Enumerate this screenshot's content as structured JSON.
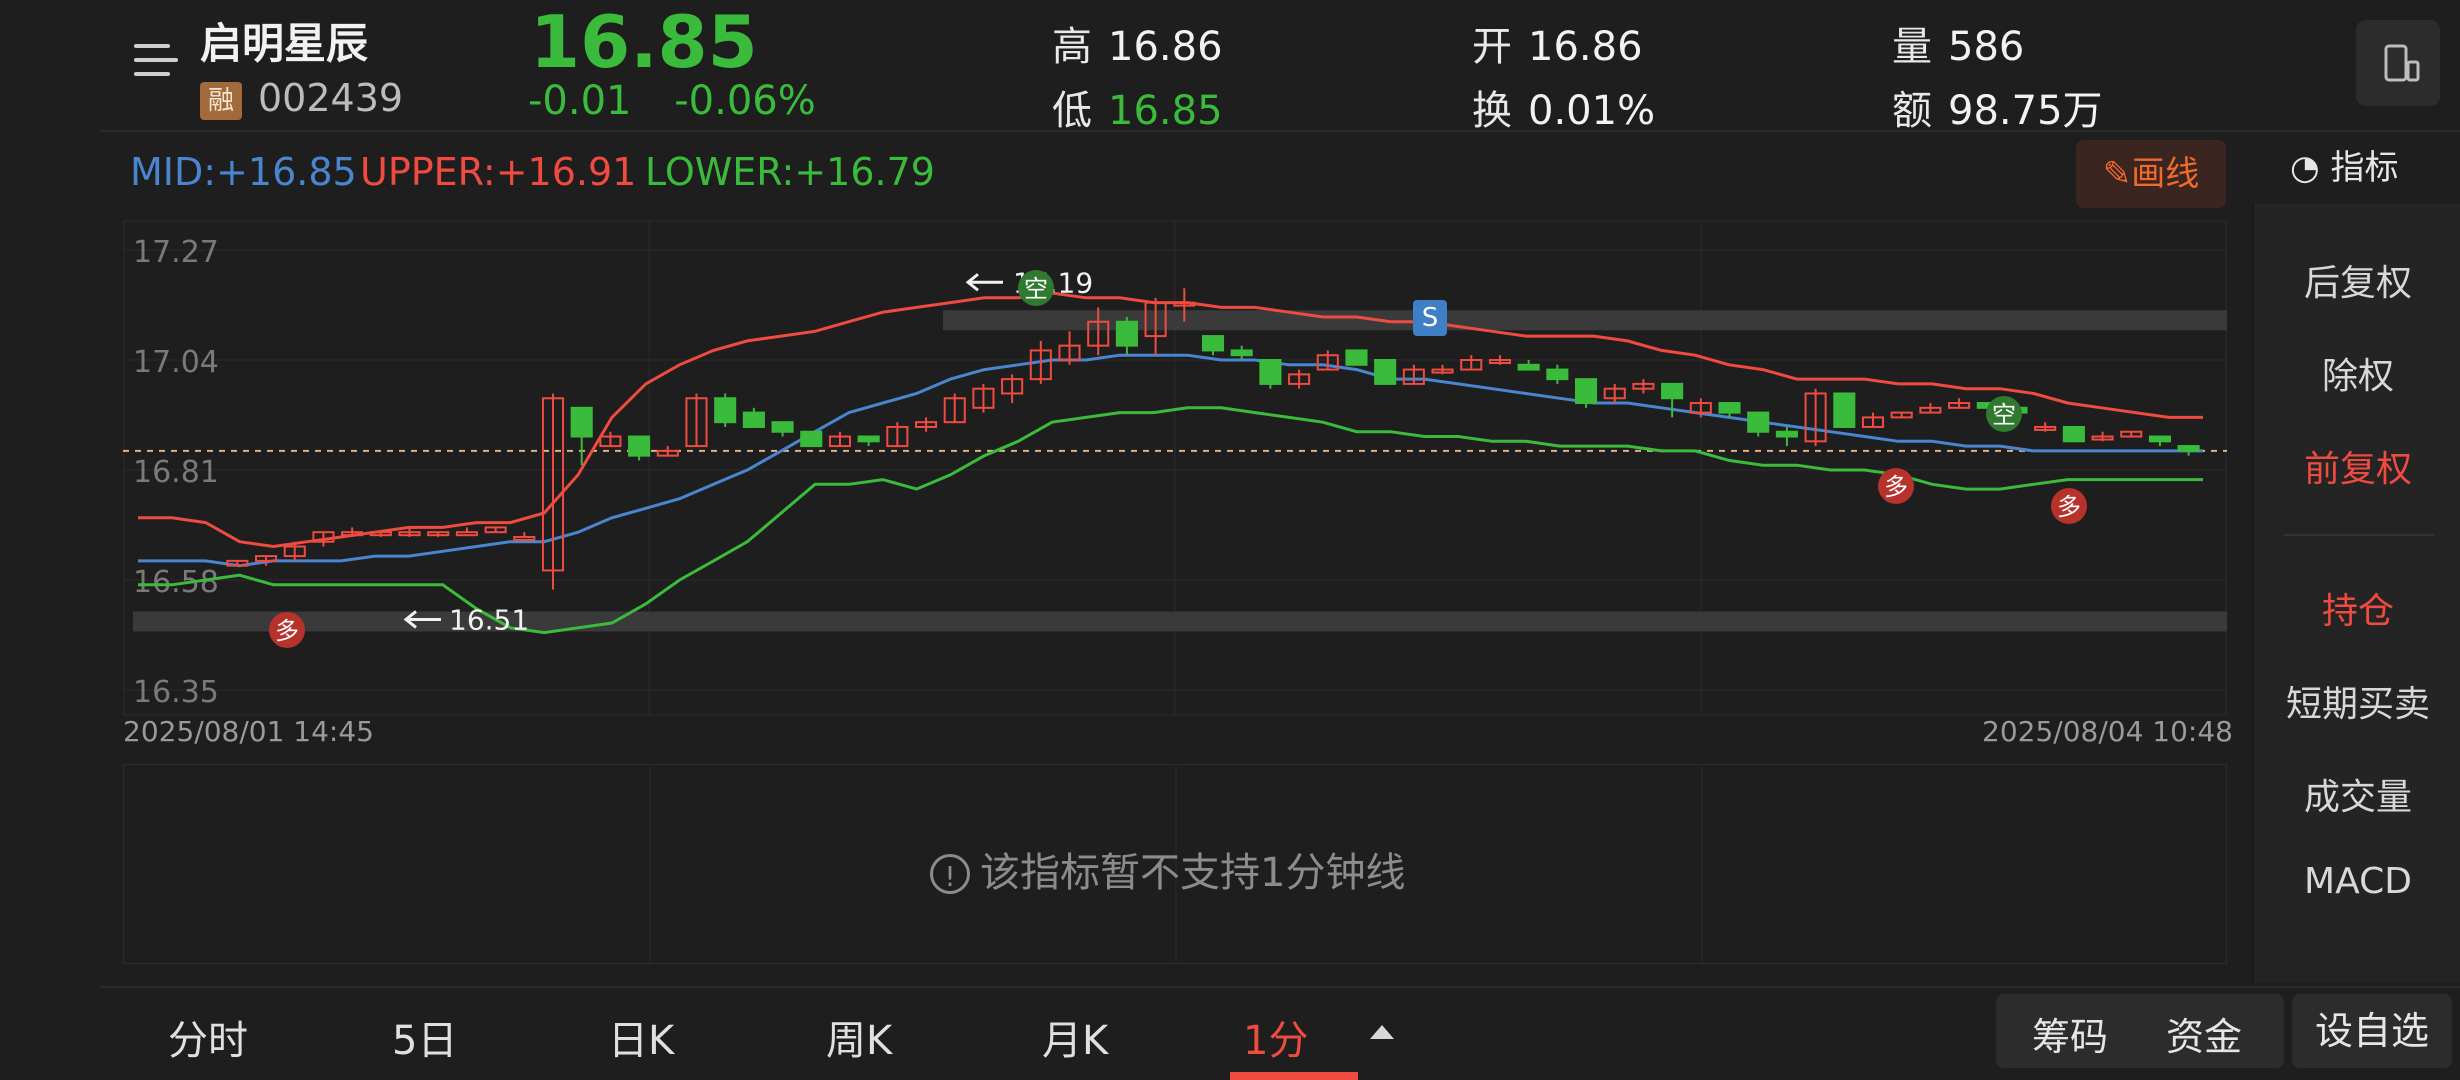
{
  "header": {
    "stock_name": "启明星辰",
    "margin_badge": "融",
    "stock_code": "002439",
    "price": "16.85",
    "change": "-0.01",
    "change_pct": "-0.06%",
    "high_label": "高",
    "high_value": "16.86",
    "low_label": "低",
    "low_value": "16.85",
    "open_label": "开",
    "open_value": "16.86",
    "turnover_label": "换",
    "turnover_value": "0.01%",
    "volume_label": "量",
    "volume_value": "586",
    "amount_label": "额",
    "amount_value": "98.75万",
    "price_color": "#3bbb3b"
  },
  "indicators": {
    "mid": "MID:+16.85",
    "upper": "UPPER:+16.91",
    "lower": "LOWER:+16.79",
    "mid_color": "#4a86d0",
    "upper_color": "#ef4b40",
    "lower_color": "#3bbb3b"
  },
  "toolbar": {
    "draw_label": "画线",
    "indicator_label": "指标"
  },
  "chart_data": {
    "type": "candlestick",
    "ylim": [
      16.35,
      17.27
    ],
    "y_ticks": [
      "17.27",
      "17.04",
      "16.81",
      "16.58",
      "16.35"
    ],
    "reference_price": 16.85,
    "start_label": "2025/08/01 14:45",
    "end_label": "2025/08/04 10:48",
    "annotations": {
      "max_label": "17.19",
      "min_label": "16.51",
      "sell_marker": "S",
      "long_marker": "多",
      "short_marker": "空"
    },
    "bands": {
      "upper": [
        16.71,
        16.71,
        16.7,
        16.66,
        16.65,
        16.66,
        16.67,
        16.68,
        16.69,
        16.69,
        16.7,
        16.7,
        16.72,
        16.8,
        16.92,
        16.99,
        17.03,
        17.06,
        17.08,
        17.09,
        17.1,
        17.12,
        17.14,
        17.15,
        17.16,
        17.17,
        17.17,
        17.18,
        17.17,
        17.17,
        17.16,
        17.16,
        17.15,
        17.15,
        17.14,
        17.13,
        17.13,
        17.12,
        17.12,
        17.11,
        17.1,
        17.09,
        17.09,
        17.09,
        17.08,
        17.06,
        17.05,
        17.03,
        17.02,
        17.0,
        17.0,
        17.0,
        16.99,
        16.99,
        16.98,
        16.98,
        16.97,
        16.95,
        16.94,
        16.93,
        16.92,
        16.92
      ],
      "mid": [
        16.62,
        16.62,
        16.62,
        16.61,
        16.62,
        16.62,
        16.62,
        16.63,
        16.63,
        16.64,
        16.65,
        16.66,
        16.66,
        16.68,
        16.71,
        16.73,
        16.75,
        16.78,
        16.81,
        16.85,
        16.89,
        16.93,
        16.95,
        16.97,
        17.0,
        17.02,
        17.03,
        17.04,
        17.04,
        17.05,
        17.05,
        17.05,
        17.04,
        17.04,
        17.03,
        17.03,
        17.02,
        17.0,
        17.0,
        16.99,
        16.98,
        16.97,
        16.96,
        16.95,
        16.95,
        16.94,
        16.93,
        16.92,
        16.91,
        16.9,
        16.89,
        16.88,
        16.87,
        16.87,
        16.86,
        16.86,
        16.85,
        16.85,
        16.85,
        16.85,
        16.85,
        16.85
      ],
      "lower": [
        16.57,
        16.57,
        16.58,
        16.59,
        16.57,
        16.57,
        16.57,
        16.57,
        16.57,
        16.57,
        16.52,
        16.48,
        16.47,
        16.48,
        16.49,
        16.53,
        16.58,
        16.62,
        16.66,
        16.72,
        16.78,
        16.78,
        16.79,
        16.77,
        16.8,
        16.84,
        16.87,
        16.91,
        16.92,
        16.93,
        16.93,
        16.94,
        16.94,
        16.93,
        16.92,
        16.91,
        16.89,
        16.89,
        16.88,
        16.88,
        16.87,
        16.87,
        16.86,
        16.86,
        16.86,
        16.85,
        16.85,
        16.83,
        16.82,
        16.82,
        16.81,
        16.81,
        16.8,
        16.78,
        16.77,
        16.77,
        16.78,
        16.79,
        16.79,
        16.79,
        16.79,
        16.79
      ]
    },
    "candles": [
      [
        16.61,
        16.62,
        16.62,
        16.61
      ],
      [
        16.62,
        16.63,
        16.63,
        16.61
      ],
      [
        16.63,
        16.65,
        16.66,
        16.62
      ],
      [
        16.66,
        16.68,
        16.68,
        16.65
      ],
      [
        16.68,
        16.68,
        16.69,
        16.67
      ],
      [
        16.68,
        16.68,
        16.68,
        16.67
      ],
      [
        16.68,
        16.68,
        16.69,
        16.67
      ],
      [
        16.68,
        16.68,
        16.68,
        16.67
      ],
      [
        16.68,
        16.68,
        16.69,
        16.68
      ],
      [
        16.68,
        16.69,
        16.69,
        16.68
      ],
      [
        16.67,
        16.67,
        16.68,
        16.67
      ],
      [
        16.6,
        16.96,
        16.97,
        16.56
      ],
      [
        16.94,
        16.88,
        16.94,
        16.82
      ],
      [
        16.86,
        16.88,
        16.89,
        16.86
      ],
      [
        16.88,
        16.84,
        16.88,
        16.83
      ],
      [
        16.84,
        16.85,
        16.86,
        16.84
      ],
      [
        16.86,
        16.96,
        16.97,
        16.86
      ],
      [
        16.96,
        16.91,
        16.97,
        16.9
      ],
      [
        16.93,
        16.9,
        16.94,
        16.9
      ],
      [
        16.91,
        16.89,
        16.91,
        16.88
      ],
      [
        16.89,
        16.86,
        16.89,
        16.86
      ],
      [
        16.86,
        16.88,
        16.89,
        16.86
      ],
      [
        16.88,
        16.87,
        16.88,
        16.86
      ],
      [
        16.86,
        16.9,
        16.91,
        16.86
      ],
      [
        16.9,
        16.91,
        16.92,
        16.89
      ],
      [
        16.91,
        16.96,
        16.97,
        16.91
      ],
      [
        16.94,
        16.98,
        16.99,
        16.93
      ],
      [
        16.97,
        17.0,
        17.01,
        16.95
      ],
      [
        17.0,
        17.06,
        17.08,
        16.99
      ],
      [
        17.04,
        17.07,
        17.1,
        17.03
      ],
      [
        17.07,
        17.12,
        17.15,
        17.05
      ],
      [
        17.12,
        17.07,
        17.13,
        17.05
      ],
      [
        17.09,
        17.16,
        17.17,
        17.05
      ],
      [
        17.16,
        17.16,
        17.19,
        17.12
      ],
      [
        17.09,
        17.06,
        17.09,
        17.05
      ],
      [
        17.06,
        17.05,
        17.07,
        17.04
      ],
      [
        17.04,
        16.99,
        17.04,
        16.98
      ],
      [
        16.99,
        17.01,
        17.02,
        16.98
      ],
      [
        17.02,
        17.05,
        17.06,
        17.02
      ],
      [
        17.06,
        17.03,
        17.06,
        17.03
      ],
      [
        17.04,
        16.99,
        17.04,
        16.99
      ],
      [
        16.99,
        17.02,
        17.03,
        16.99
      ],
      [
        17.02,
        17.02,
        17.03,
        17.01
      ],
      [
        17.02,
        17.04,
        17.05,
        17.02
      ],
      [
        17.04,
        17.04,
        17.05,
        17.03
      ],
      [
        17.03,
        17.02,
        17.04,
        17.02
      ],
      [
        17.02,
        17.0,
        17.03,
        16.99
      ],
      [
        17.0,
        16.95,
        17.0,
        16.94
      ],
      [
        16.96,
        16.98,
        16.99,
        16.95
      ],
      [
        16.98,
        16.99,
        17.0,
        16.97
      ],
      [
        16.99,
        16.96,
        16.99,
        16.92
      ],
      [
        16.93,
        16.95,
        16.96,
        16.92
      ],
      [
        16.95,
        16.93,
        16.95,
        16.92
      ],
      [
        16.93,
        16.89,
        16.93,
        16.88
      ],
      [
        16.89,
        16.88,
        16.9,
        16.86
      ],
      [
        16.87,
        16.97,
        16.98,
        16.86
      ],
      [
        16.97,
        16.9,
        16.97,
        16.9
      ],
      [
        16.9,
        16.92,
        16.93,
        16.9
      ],
      [
        16.92,
        16.93,
        16.93,
        16.92
      ],
      [
        16.93,
        16.94,
        16.95,
        16.93
      ],
      [
        16.94,
        16.95,
        16.96,
        16.94
      ],
      [
        16.95,
        16.94,
        16.95,
        16.93
      ],
      [
        16.94,
        16.93,
        16.94,
        16.92
      ],
      [
        16.9,
        16.9,
        16.91,
        16.89
      ],
      [
        16.9,
        16.87,
        16.9,
        16.87
      ],
      [
        16.88,
        16.88,
        16.89,
        16.87
      ],
      [
        16.88,
        16.89,
        16.89,
        16.88
      ],
      [
        16.88,
        16.87,
        16.88,
        16.86
      ],
      [
        16.86,
        16.85,
        16.86,
        16.84
      ]
    ]
  },
  "sub_chart": {
    "message": "该指标暂不支持1分钟线"
  },
  "side_panel": {
    "items": [
      "后复权",
      "除权",
      "前复权",
      "持仓",
      "短期买卖",
      "成交量",
      "MACD"
    ]
  },
  "bottom_tabs": [
    "分时",
    "5日",
    "日K",
    "周K",
    "月K",
    "1分"
  ],
  "bottom_buttons": {
    "chips": "筹码",
    "funds": "资金",
    "add_watch": "设自选"
  }
}
